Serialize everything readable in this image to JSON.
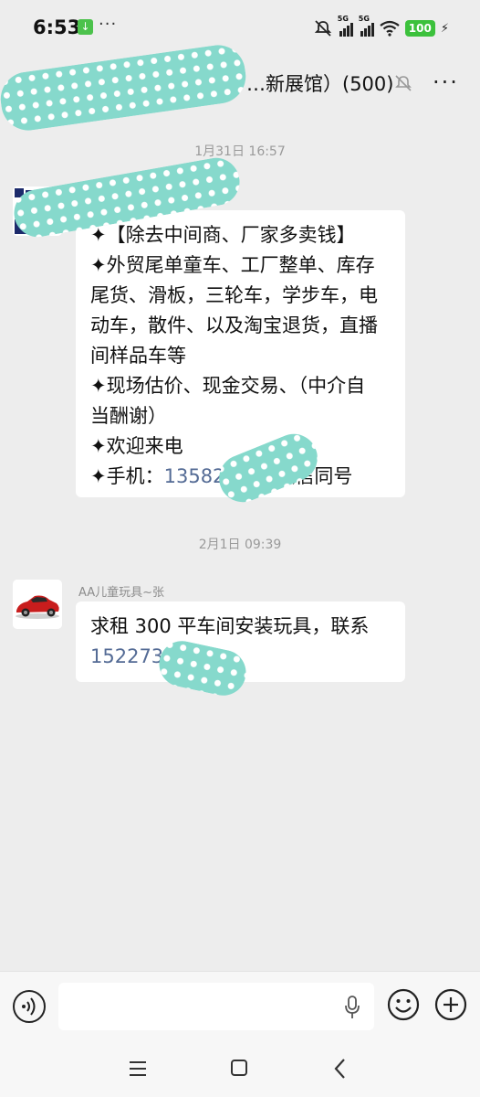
{
  "status": {
    "time": "6:53",
    "more": "···",
    "signal_1": "5G",
    "signal_2": "5G",
    "battery": "100"
  },
  "header": {
    "title": "…新展馆）(500)",
    "more": "···"
  },
  "messages": [
    {
      "timestamp": "1月31日 16:57",
      "sender": "…",
      "lines": [
        {
          "text": "✦【除去中间商、厂家多卖钱】"
        },
        {
          "text": "✦外贸尾单童车、工厂整单、库存"
        },
        {
          "text": "尾货、滑板，三轮车，学步车，电"
        },
        {
          "text": "动车，散件、以及淘宝退货，直播"
        },
        {
          "text": "间样品车等"
        },
        {
          "text": "✦现场估价、现金交易、（中介自"
        },
        {
          "text": "当酬谢）"
        },
        {
          "text": "✦欢迎来电"
        },
        {
          "text": "✦手机：",
          "phone": "13582",
          "rest": "微信同号"
        }
      ]
    },
    {
      "timestamp": "2月1日 09:39",
      "sender": "AA儿童玩具~张",
      "lines": [
        {
          "text": "求租 300 平车间安装玩具，联系"
        },
        {
          "text": "",
          "phone": "1522736"
        }
      ]
    }
  ],
  "input": {
    "placeholder": ""
  },
  "colors": {
    "background": "#ededed",
    "bubble": "#ffffff",
    "phone_link": "#546b95",
    "battery": "#3cc13c",
    "redaction": "#86d9cc"
  }
}
